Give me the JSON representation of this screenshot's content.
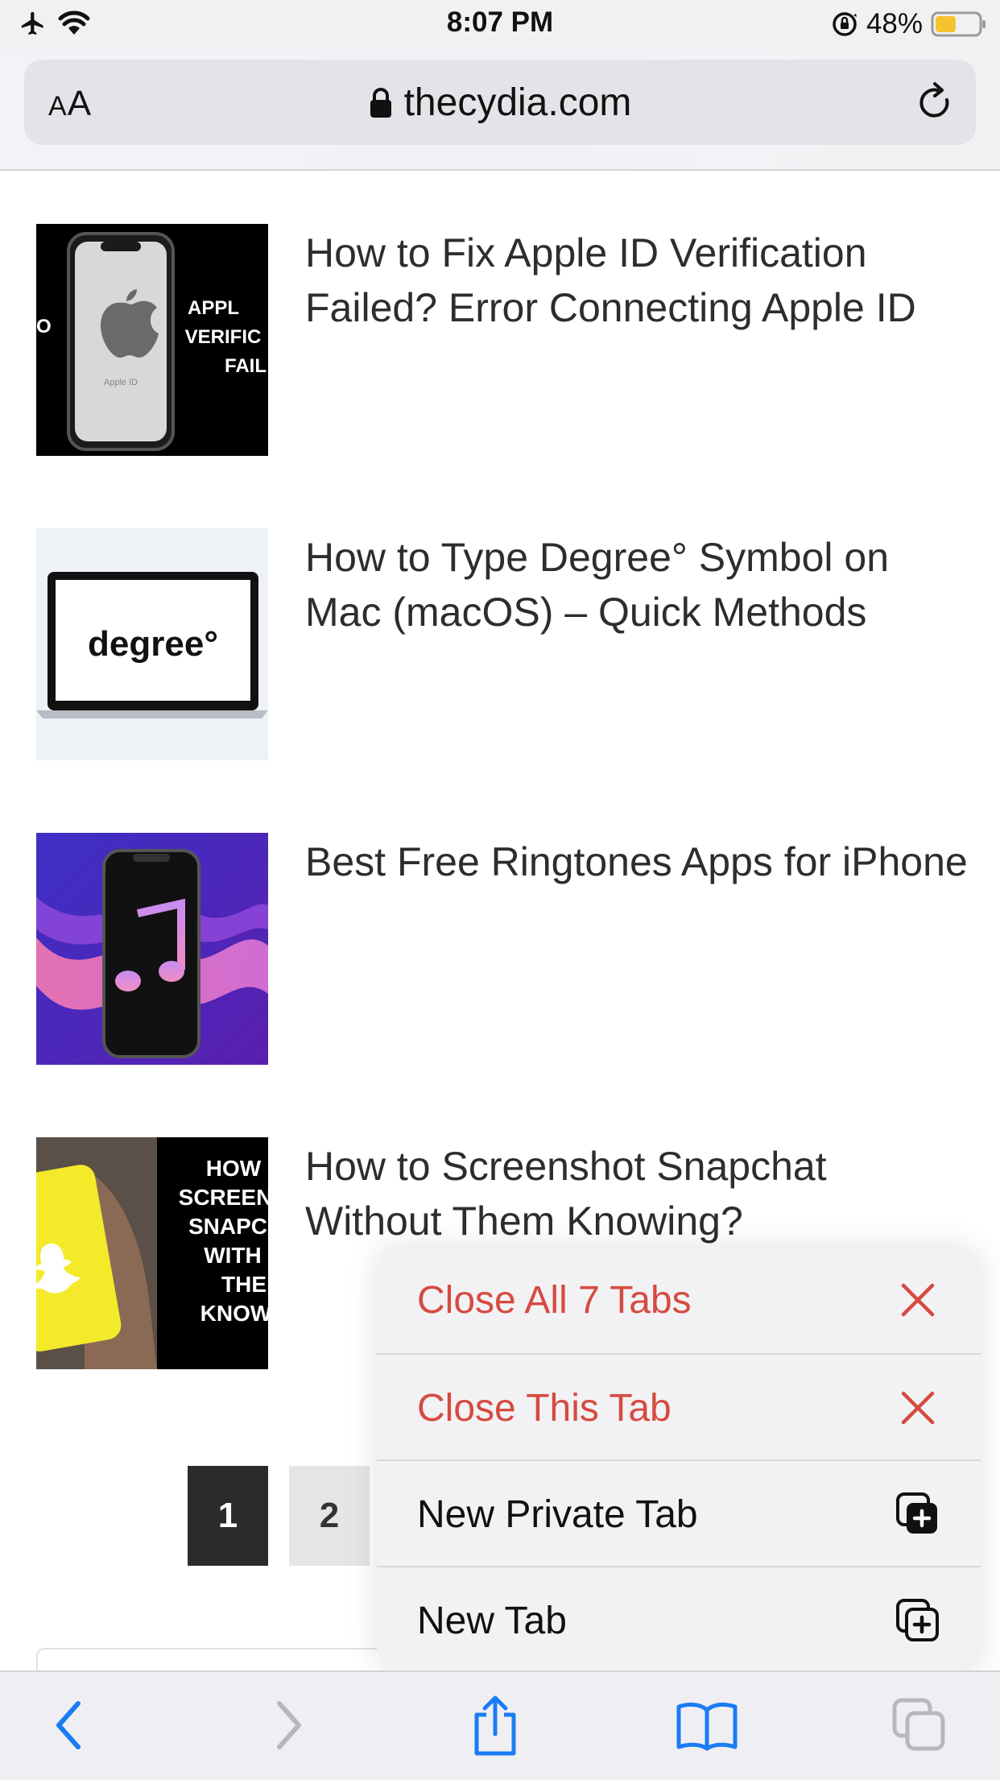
{
  "status_bar": {
    "time": "8:07 PM",
    "battery_percent": "48%",
    "battery_level": 0.48,
    "icons": [
      "airplane-icon",
      "wifi-icon",
      "orientation-lock-icon",
      "battery-icon"
    ]
  },
  "address_bar": {
    "aa_large": "A",
    "aa_small": "A",
    "url": "thecydia.com",
    "icons": [
      "lock-icon",
      "reload-icon"
    ]
  },
  "articles": [
    {
      "title": "How to Fix Apple ID Verification Failed? Error Connecting Apple ID",
      "thumb_text": [
        "APPL",
        "VERIFIC",
        "FAIL"
      ],
      "thumb_left_text": "O",
      "thumb_small_text": "Apple ID"
    },
    {
      "title": "How to Type Degree° Symbol on Mac (macOS) – Quick Methods",
      "thumb_text": "degree°"
    },
    {
      "title": "Best Free Ringtones Apps for iPhone"
    },
    {
      "title": "How to Screenshot Snapchat Without Them Knowing?",
      "thumb_text": [
        "HOW",
        "SCREEN",
        "SNAPC",
        "WITH",
        "THE",
        "KNOW"
      ]
    }
  ],
  "pagination": {
    "pages": [
      "1",
      "2"
    ],
    "current": "1"
  },
  "context_menu": {
    "items": [
      {
        "label": "Close All 7 Tabs",
        "icon": "close-icon",
        "style": "destructive"
      },
      {
        "label": "Close This Tab",
        "icon": "close-icon",
        "style": "destructive"
      },
      {
        "label": "New Private Tab",
        "icon": "private-tab-plus-icon",
        "style": "normal"
      },
      {
        "label": "New Tab",
        "icon": "new-tab-plus-icon",
        "style": "normal"
      }
    ]
  },
  "toolbar": {
    "icons": [
      "back-icon",
      "forward-icon",
      "share-icon",
      "bookmarks-icon",
      "tabs-icon"
    ]
  },
  "colors": {
    "accent": "#1a7cf3",
    "destructive": "#d64a40",
    "battery_fill": "#f4c430"
  }
}
